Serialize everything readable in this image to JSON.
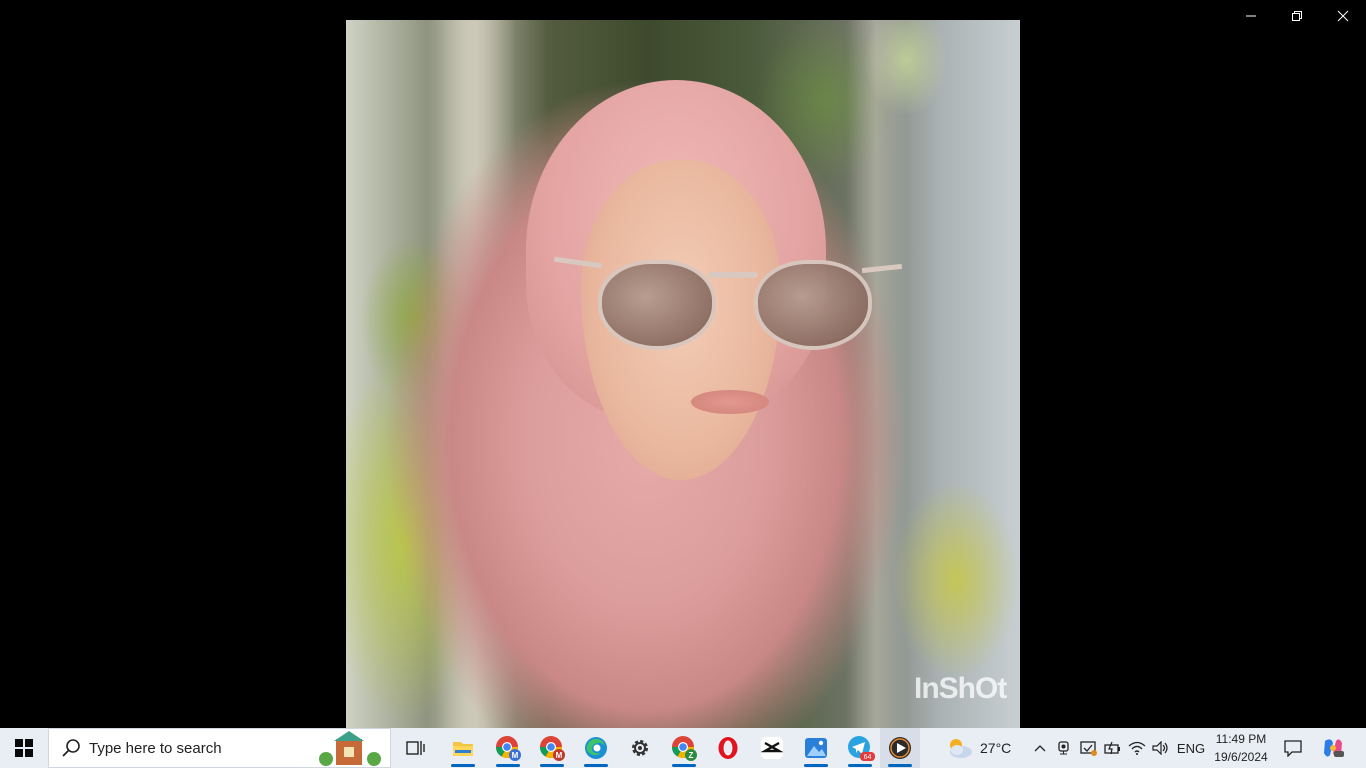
{
  "window": {
    "minimize_label": "minimize",
    "maximize_label": "restore",
    "close_label": "close"
  },
  "photo": {
    "watermark": "InShOt"
  },
  "taskbar": {
    "search_placeholder": "Type here to search",
    "apps": [
      {
        "name": "task-view",
        "icon": "task-view-icon"
      },
      {
        "name": "file-explorer",
        "icon": "folder-icon"
      },
      {
        "name": "chrome-profile-m1",
        "icon": "chrome-icon",
        "badge": "M"
      },
      {
        "name": "chrome-profile-m2",
        "icon": "chrome-icon",
        "badge": "M"
      },
      {
        "name": "edge",
        "icon": "edge-icon"
      },
      {
        "name": "settings",
        "icon": "gear-icon"
      },
      {
        "name": "chrome-profile-z",
        "icon": "chrome-icon",
        "badge": "Z"
      },
      {
        "name": "opera",
        "icon": "opera-icon"
      },
      {
        "name": "capcut",
        "icon": "capcut-icon"
      },
      {
        "name": "photos",
        "icon": "photos-icon"
      },
      {
        "name": "telegram",
        "icon": "telegram-icon",
        "badge": "64"
      },
      {
        "name": "media-player",
        "icon": "play-icon"
      }
    ],
    "weather": {
      "temp": "27°C",
      "icon": "partly-cloudy-icon"
    },
    "language": "ENG",
    "clock": {
      "time": "11:49 PM",
      "date": "19/6/2024"
    },
    "badges": {
      "chrome_m": "M",
      "chrome_z": "Z",
      "telegram": "64"
    },
    "colors": {
      "accent": "#0067c0",
      "taskbar_bg": "#e9eef4"
    }
  }
}
